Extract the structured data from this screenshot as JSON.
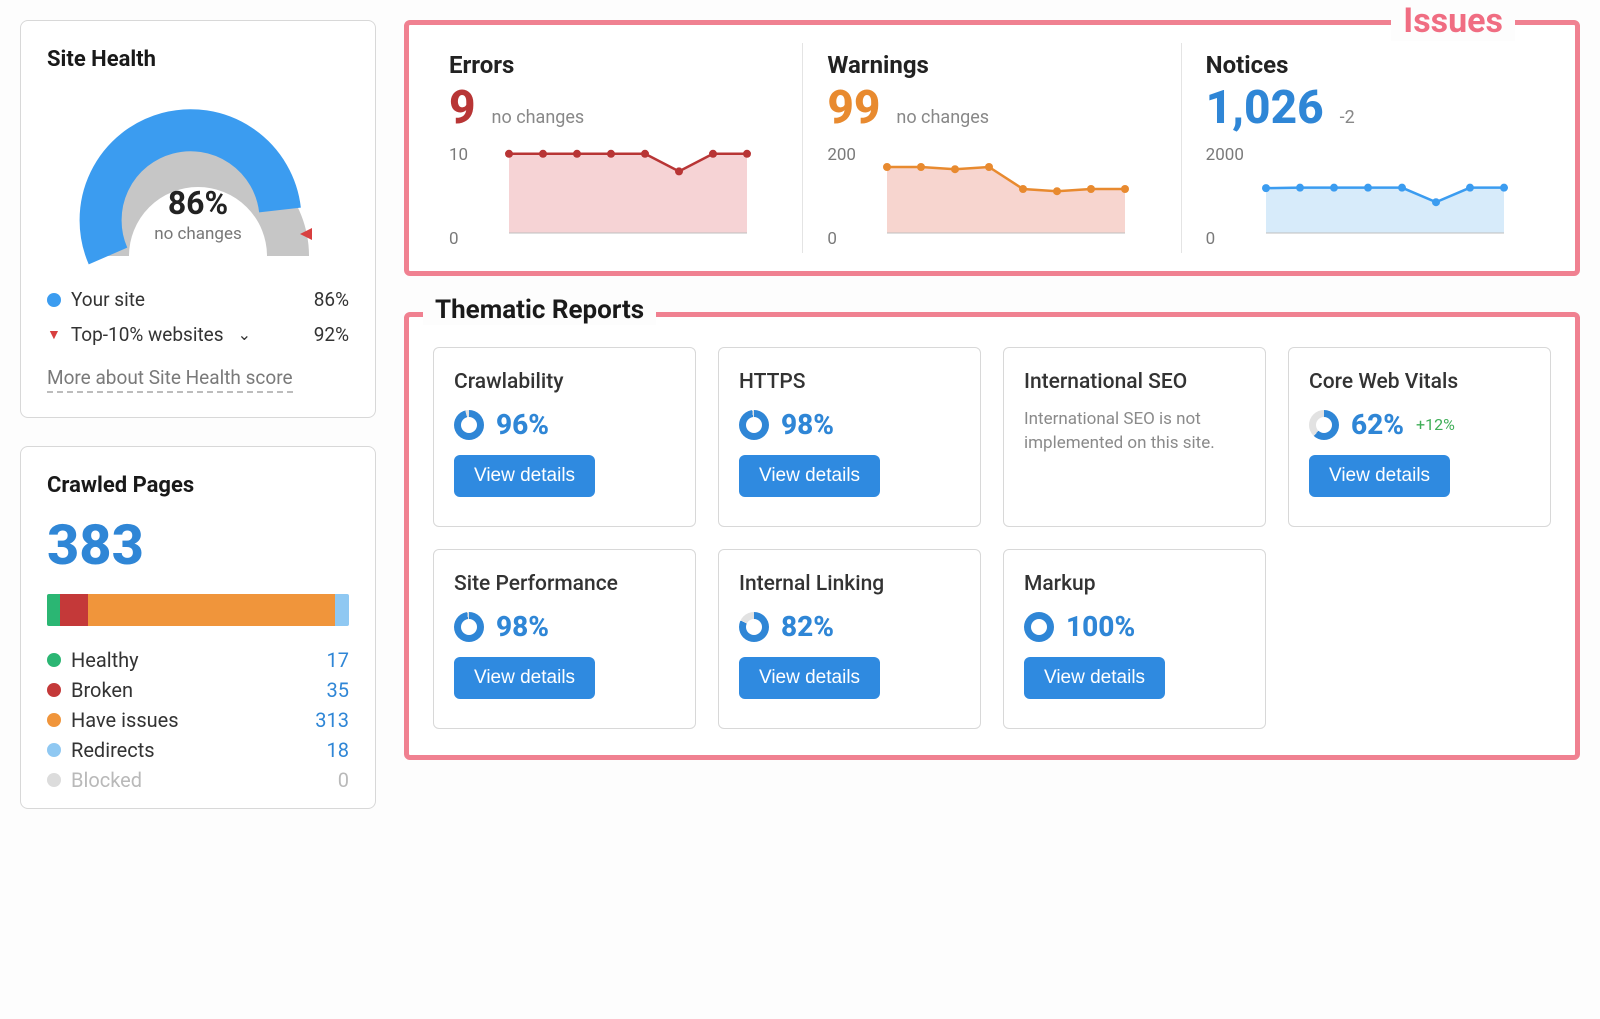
{
  "siteHealth": {
    "title": "Site Health",
    "percent": "86%",
    "sub": "no changes",
    "legend": {
      "yourSiteLabel": "Your site",
      "yourSitePct": "86%",
      "topLabel": "Top-10% websites",
      "topPct": "92%"
    },
    "moreLink": "More about Site Health score",
    "gaugeColors": {
      "fill": "#3b9cf0",
      "track": "#c6c6c6",
      "marker": "#d83f3f"
    }
  },
  "crawledPages": {
    "title": "Crawled Pages",
    "total": "383",
    "segments": [
      {
        "name": "Healthy",
        "value": "17",
        "color": "#2bb673"
      },
      {
        "name": "Broken",
        "value": "35",
        "color": "#c43939"
      },
      {
        "name": "Have issues",
        "value": "313",
        "color": "#f0953b"
      },
      {
        "name": "Redirects",
        "value": "18",
        "color": "#8fc8f2"
      },
      {
        "name": "Blocked",
        "value": "0",
        "color": "#dcdcdc",
        "dim": true
      }
    ]
  },
  "issues": {
    "sectionLabel": "Issues",
    "errors": {
      "title": "Errors",
      "value": "9",
      "delta": "no changes",
      "axisTop": "10",
      "axisBottom": "0",
      "color": "#b83535",
      "fill": "#f6d3d5"
    },
    "warnings": {
      "title": "Warnings",
      "value": "99",
      "delta": "no changes",
      "axisTop": "200",
      "axisBottom": "0",
      "color": "#e88a2f",
      "fill": "#f7d5cf"
    },
    "notices": {
      "title": "Notices",
      "value": "1,026",
      "delta": "-2",
      "axisTop": "2000",
      "axisBottom": "0",
      "color": "#3b9cf0",
      "fill": "#d7ebfa"
    }
  },
  "thematic": {
    "sectionLabel": "Thematic Reports",
    "viewLabel": "View details",
    "cards": [
      {
        "title": "Crawlability",
        "pct": "96%",
        "pctNum": 96
      },
      {
        "title": "HTTPS",
        "pct": "98%",
        "pctNum": 98
      },
      {
        "title": "International SEO",
        "note": "International SEO is not implemented on this site."
      },
      {
        "title": "Core Web Vitals",
        "pct": "62%",
        "pctNum": 62,
        "delta": "+12%"
      },
      {
        "title": "Site Performance",
        "pct": "98%",
        "pctNum": 98
      },
      {
        "title": "Internal Linking",
        "pct": "82%",
        "pctNum": 82
      },
      {
        "title": "Markup",
        "pct": "100%",
        "pctNum": 100
      }
    ]
  },
  "chart_data": [
    {
      "type": "line",
      "title": "Errors",
      "ylim": [
        0,
        10
      ],
      "values": [
        9,
        9,
        9,
        9,
        9,
        7,
        9,
        9
      ]
    },
    {
      "type": "line",
      "title": "Warnings",
      "ylim": [
        0,
        200
      ],
      "values": [
        150,
        150,
        145,
        150,
        100,
        95,
        100,
        100
      ]
    },
    {
      "type": "line",
      "title": "Notices",
      "ylim": [
        0,
        2000
      ],
      "values": [
        1020,
        1030,
        1030,
        1030,
        1030,
        700,
        1030,
        1030
      ]
    },
    {
      "type": "bar",
      "title": "Crawled Pages breakdown",
      "categories": [
        "Healthy",
        "Broken",
        "Have issues",
        "Redirects",
        "Blocked"
      ],
      "values": [
        17,
        35,
        313,
        18,
        0
      ]
    }
  ]
}
